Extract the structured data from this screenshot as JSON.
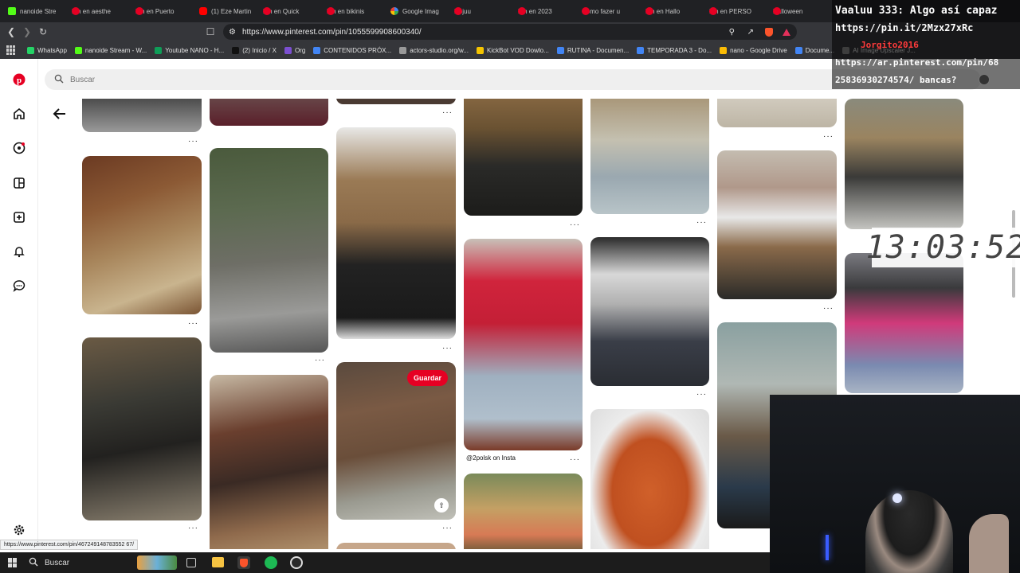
{
  "browser": {
    "tabs": [
      {
        "label": "nanoide Stre",
        "icon": "kick"
      },
      {
        "label": "Pin en aesthe",
        "icon": "pin"
      },
      {
        "label": "Pin en Puerto",
        "icon": "pin"
      },
      {
        "label": "(1) Eze Martin",
        "icon": "yt"
      },
      {
        "label": "Pin en Quick",
        "icon": "pin"
      },
      {
        "label": "Pin en bikinis",
        "icon": "pin"
      },
      {
        "label": "Google Imag",
        "icon": "g"
      },
      {
        "label": "Rojuu",
        "icon": "pin"
      },
      {
        "label": "Pin en 2023",
        "icon": "pin"
      },
      {
        "label": "Como fazer u",
        "icon": "pin"
      },
      {
        "label": "Pin en Hallo",
        "icon": "pin"
      },
      {
        "label": "Pin en PERSO",
        "icon": "pin"
      },
      {
        "label": "Halloween",
        "icon": "pin"
      }
    ],
    "url": "https://www.pinterest.com/pin/1055599908600340/",
    "bookmarks": [
      {
        "label": "WhatsApp",
        "color": "#25d366"
      },
      {
        "label": "nanoide Stream - W...",
        "color": "#53fc18"
      },
      {
        "label": "Youtube NANO - H...",
        "color": "#0f9d58"
      },
      {
        "label": "(2) Inicio / X",
        "color": "#111111"
      },
      {
        "label": "Org",
        "color": "#7b4fd0"
      },
      {
        "label": "CONTENIDOS PRÓX...",
        "color": "#4285f4"
      },
      {
        "label": "actors-studio.org/w...",
        "color": "#999999"
      },
      {
        "label": "KickBot VOD Dowlo...",
        "color": "#f5c400"
      },
      {
        "label": "RUTINA - Documen...",
        "color": "#4285f4"
      },
      {
        "label": "TEMPORADA 3 - Do...",
        "color": "#4285f4"
      },
      {
        "label": "nano - Google Drive",
        "color": "#fbbc05"
      },
      {
        "label": "Docume...",
        "color": "#4285f4"
      },
      {
        "label": "AI Image Upscaler J...",
        "color": "#888888"
      }
    ]
  },
  "pinterest": {
    "search_placeholder": "Buscar",
    "save_button": "Guardar",
    "pin_caption": "@2polsk on Insta",
    "status_url": "https://www.pinterest.com/pin/467249148783552 67/"
  },
  "overlay": {
    "chat_lines": [
      {
        "text": "Vaaluu 333: Algo así capaz",
        "color": "#ffffff"
      },
      {
        "text": "https://pin.it/2Mzx27xRc",
        "color": "#ffffff"
      },
      {
        "text": "Jorgito2016",
        "color": "#ff3b3b"
      },
      {
        "text": "https://ar.pinterest.com/pin/68",
        "color": "#ffffff"
      },
      {
        "text": "25836930274574/ bancas?",
        "color": "#ffffff"
      }
    ],
    "clock": "13:03:52"
  },
  "taskbar": {
    "search_label": "Buscar"
  }
}
